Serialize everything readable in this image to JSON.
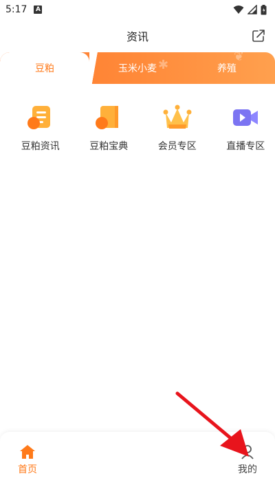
{
  "status_bar": {
    "time": "5:17",
    "badge": "A"
  },
  "header": {
    "title": "资讯",
    "share_icon": "share-icon"
  },
  "tabs": [
    {
      "label": "豆粕",
      "active": true
    },
    {
      "label": "玉米小麦",
      "active": false
    },
    {
      "label": "养殖",
      "active": false
    }
  ],
  "categories": [
    {
      "label": "豆粕资讯",
      "icon": "news-doc-icon"
    },
    {
      "label": "豆粕宝典",
      "icon": "book-icon"
    },
    {
      "label": "会员专区",
      "icon": "crown-icon"
    },
    {
      "label": "直播专区",
      "icon": "video-camera-icon"
    }
  ],
  "bottom_nav": [
    {
      "label": "首页",
      "icon": "home-icon",
      "active": true
    },
    {
      "label": "我的",
      "icon": "user-icon",
      "active": false
    }
  ],
  "colors": {
    "accent": "#ff7a1a",
    "tab_gradient_start": "#ff7a2c",
    "tab_gradient_end": "#ffa04e",
    "arrow": "#e8141c"
  }
}
